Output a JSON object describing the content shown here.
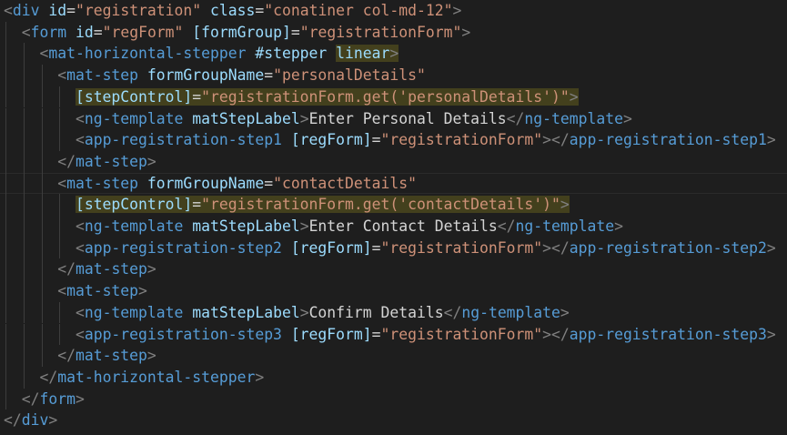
{
  "editor": {
    "colors": {
      "background": "#1e1e1e",
      "punctuation": "#808080",
      "tag": "#569cd6",
      "attribute": "#9cdcfe",
      "equals": "#d4d4d4",
      "string": "#ce9178",
      "text": "#d4d4d4",
      "bracket_highlight": "#625c1e"
    },
    "lines": [
      {
        "indent": 0,
        "tokens": [
          [
            "p",
            "<"
          ],
          [
            "tag",
            "div"
          ],
          [
            "txt",
            " "
          ],
          [
            "attr",
            "id"
          ],
          [
            "eq",
            "="
          ],
          [
            "str",
            "\"registration\""
          ],
          [
            "txt",
            " "
          ],
          [
            "attr",
            "class"
          ],
          [
            "eq",
            "="
          ],
          [
            "str",
            "\"conatiner col-md-12\""
          ],
          [
            "p",
            ">"
          ]
        ]
      },
      {
        "indent": 1,
        "tokens": [
          [
            "p",
            "<"
          ],
          [
            "tag",
            "form"
          ],
          [
            "txt",
            " "
          ],
          [
            "attr",
            "id"
          ],
          [
            "eq",
            "="
          ],
          [
            "str",
            "\"regForm\""
          ],
          [
            "txt",
            " "
          ],
          [
            "attr",
            "[formGroup]"
          ],
          [
            "eq",
            "="
          ],
          [
            "str",
            "\"registrationForm\""
          ],
          [
            "p",
            ">"
          ]
        ]
      },
      {
        "indent": 2,
        "tokens": [
          [
            "p",
            "<"
          ],
          [
            "tag",
            "mat-horizontal-stepper"
          ],
          [
            "txt",
            " "
          ],
          [
            "attr",
            "#stepper"
          ],
          [
            "txt",
            " "
          ],
          [
            "attrhl",
            "linear"
          ],
          [
            "phl",
            ">"
          ]
        ]
      },
      {
        "indent": 3,
        "tokens": [
          [
            "p",
            "<"
          ],
          [
            "tag",
            "mat-step"
          ],
          [
            "txt",
            " "
          ],
          [
            "attr",
            "formGroupName"
          ],
          [
            "eq",
            "="
          ],
          [
            "str",
            "\"personalDetails\""
          ]
        ]
      },
      {
        "indent": 4,
        "tokens": [
          [
            "attrhl",
            "[stepControl]"
          ],
          [
            "eqhl",
            "="
          ],
          [
            "strhl",
            "\"registrationForm.get('personalDetails')\""
          ],
          [
            "phl",
            ">"
          ]
        ]
      },
      {
        "indent": 4,
        "tokens": [
          [
            "p",
            "<"
          ],
          [
            "tag",
            "ng-template"
          ],
          [
            "txt",
            " "
          ],
          [
            "attr",
            "matStepLabel"
          ],
          [
            "p",
            ">"
          ],
          [
            "txt",
            "Enter Personal Details"
          ],
          [
            "p",
            "</"
          ],
          [
            "tag",
            "ng-template"
          ],
          [
            "p",
            ">"
          ]
        ]
      },
      {
        "indent": 4,
        "tokens": [
          [
            "p",
            "<"
          ],
          [
            "tag",
            "app-registration-step1"
          ],
          [
            "txt",
            " "
          ],
          [
            "attr",
            "[regForm]"
          ],
          [
            "eq",
            "="
          ],
          [
            "str",
            "\"registrationForm\""
          ],
          [
            "p",
            "></"
          ],
          [
            "tag",
            "app-registration-step1"
          ],
          [
            "p",
            ">"
          ]
        ]
      },
      {
        "indent": 3,
        "tokens": [
          [
            "p",
            "</"
          ],
          [
            "tag",
            "mat-step"
          ],
          [
            "p",
            ">"
          ]
        ]
      },
      {
        "indent": 3,
        "active": true,
        "tokens": [
          [
            "p",
            "<"
          ],
          [
            "tag",
            "mat-step"
          ],
          [
            "txt",
            " "
          ],
          [
            "attr",
            "formGroupName"
          ],
          [
            "eq",
            "="
          ],
          [
            "str",
            "\"contactDetails\""
          ]
        ]
      },
      {
        "indent": 4,
        "tokens": [
          [
            "attrhl",
            "[stepControl]"
          ],
          [
            "eqhl",
            "="
          ],
          [
            "strhl",
            "\"registrationForm.get('contactDetails')\""
          ],
          [
            "phl",
            ">"
          ]
        ]
      },
      {
        "indent": 4,
        "tokens": [
          [
            "p",
            "<"
          ],
          [
            "tag",
            "ng-template"
          ],
          [
            "txt",
            " "
          ],
          [
            "attr",
            "matStepLabel"
          ],
          [
            "p",
            ">"
          ],
          [
            "txt",
            "Enter Contact Details"
          ],
          [
            "p",
            "</"
          ],
          [
            "tag",
            "ng-template"
          ],
          [
            "p",
            ">"
          ]
        ]
      },
      {
        "indent": 4,
        "tokens": [
          [
            "p",
            "<"
          ],
          [
            "tag",
            "app-registration-step2"
          ],
          [
            "txt",
            " "
          ],
          [
            "attr",
            "[regForm]"
          ],
          [
            "eq",
            "="
          ],
          [
            "str",
            "\"registrationForm\""
          ],
          [
            "p",
            "></"
          ],
          [
            "tag",
            "app-registration-step2"
          ],
          [
            "p",
            ">"
          ]
        ]
      },
      {
        "indent": 3,
        "tokens": [
          [
            "p",
            "</"
          ],
          [
            "tag",
            "mat-step"
          ],
          [
            "p",
            ">"
          ]
        ]
      },
      {
        "indent": 3,
        "tokens": [
          [
            "p",
            "<"
          ],
          [
            "tag",
            "mat-step"
          ],
          [
            "p",
            ">"
          ]
        ]
      },
      {
        "indent": 4,
        "tokens": [
          [
            "p",
            "<"
          ],
          [
            "tag",
            "ng-template"
          ],
          [
            "txt",
            " "
          ],
          [
            "attr",
            "matStepLabel"
          ],
          [
            "p",
            ">"
          ],
          [
            "txt",
            "Confirm Details"
          ],
          [
            "p",
            "</"
          ],
          [
            "tag",
            "ng-template"
          ],
          [
            "p",
            ">"
          ]
        ]
      },
      {
        "indent": 4,
        "tokens": [
          [
            "p",
            "<"
          ],
          [
            "tag",
            "app-registration-step3"
          ],
          [
            "txt",
            " "
          ],
          [
            "attr",
            "[regForm]"
          ],
          [
            "eq",
            "="
          ],
          [
            "str",
            "\"registrationForm\""
          ],
          [
            "p",
            "></"
          ],
          [
            "tag",
            "app-registration-step3"
          ],
          [
            "p",
            ">"
          ]
        ]
      },
      {
        "indent": 3,
        "tokens": [
          [
            "p",
            "</"
          ],
          [
            "tag",
            "mat-step"
          ],
          [
            "p",
            ">"
          ]
        ]
      },
      {
        "indent": 2,
        "tokens": [
          [
            "p",
            "</"
          ],
          [
            "tag",
            "mat-horizontal-stepper"
          ],
          [
            "p",
            ">"
          ]
        ]
      },
      {
        "indent": 1,
        "tokens": [
          [
            "p",
            "</"
          ],
          [
            "tag",
            "form"
          ],
          [
            "p",
            ">"
          ]
        ]
      },
      {
        "indent": 0,
        "tokens": [
          [
            "p",
            "</"
          ],
          [
            "tag",
            "div"
          ],
          [
            "p",
            ">"
          ]
        ]
      }
    ]
  }
}
